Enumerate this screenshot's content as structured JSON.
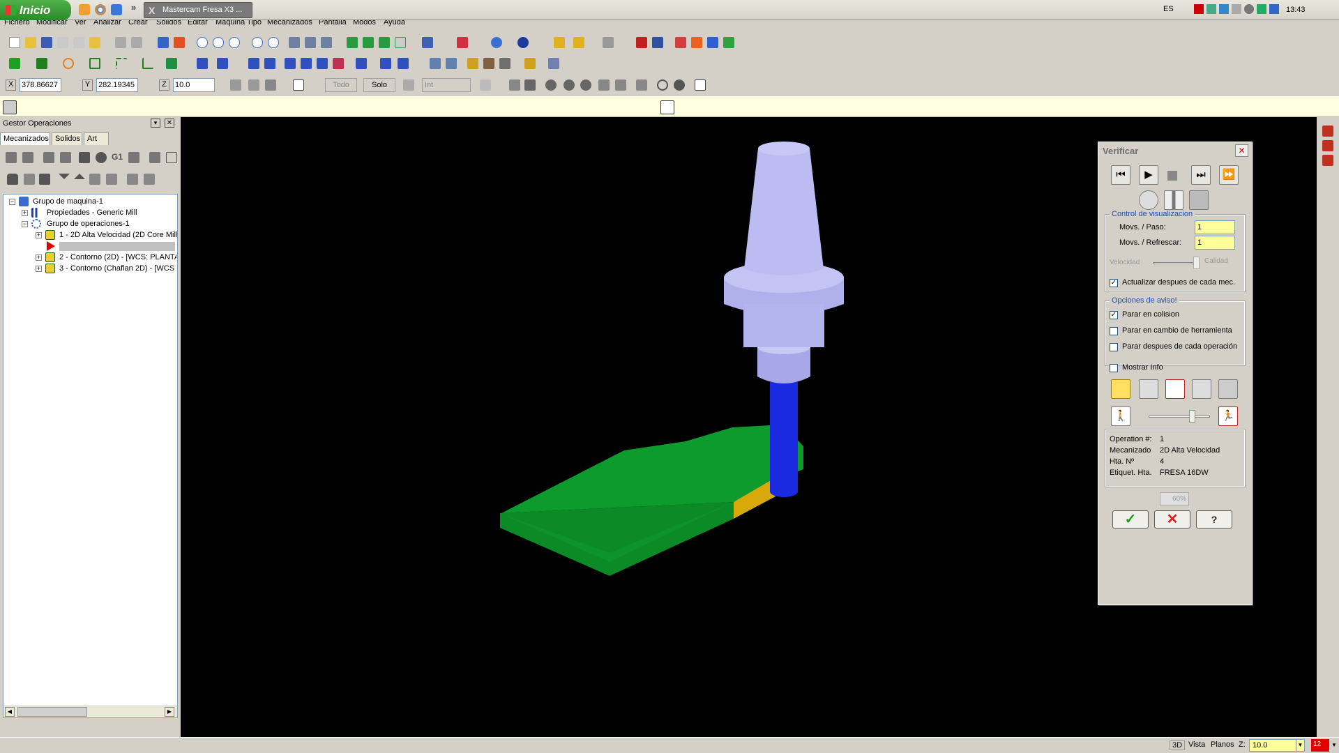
{
  "taskbar": {
    "start_label": "Inicio",
    "task_button": "Mastercam Fresa X3 ...",
    "lang": "ES",
    "clock": "13:43",
    "chevron": "»"
  },
  "menu": [
    "Fichero",
    "Modificar",
    "Ver",
    "Analizar",
    "Crear",
    "Solidos",
    "Editar",
    "Maquina Tipo",
    "Mecanizados",
    "Pantalla",
    "Modos",
    "Ayuda"
  ],
  "coords": {
    "x_label": "X",
    "x_value": "378.86627",
    "y_label": "Y",
    "y_value": "282.19345",
    "z_label": "Z",
    "z_value": "10.0",
    "todo": "Todo",
    "solo": "Solo",
    "int": "Int"
  },
  "ops_manager": {
    "title": "Gestor Operaciones",
    "tabs": [
      "Mecanizados",
      "Solidos",
      "Art"
    ],
    "tree": {
      "root": "Grupo de maquina-1",
      "properties": "Propiedades - Generic Mill",
      "group": "Grupo de operaciones-1",
      "ops": [
        "1 - 2D Alta Velocidad (2D Core Mill)",
        "2 - Contorno  (2D) - [WCS: PLANTA",
        "3 - Contorno  (Chaflan 2D) - [WCS"
      ]
    }
  },
  "verify": {
    "title": "Verificar",
    "display_group": "Control de visualizacion",
    "movs_paso_label": "Movs. / Paso:",
    "movs_paso_value": "1",
    "movs_refrescar_label": "Movs. / Refrescar:",
    "movs_refrescar_value": "1",
    "velocidad": "Velocidad",
    "calidad": "Calidad",
    "actualizar": "Actualizar despues de cada mec.",
    "warn_group": "Opciones de aviso!",
    "parar_colision": "Parar en colision",
    "parar_cambio": "Parar en cambio de herramienta",
    "parar_despues": "Parar despues de cada operación",
    "mostrar_info": "Mostrar Info",
    "info": {
      "op_label": "Operation #:",
      "op_value": "1",
      "mec_label": "Mecanizado",
      "mec_value": "2D Alta Velocidad",
      "hta_label": "Hta. Nº",
      "hta_value": "4",
      "etiq_label": "Etiquet. Hta.",
      "etiq_value": "FRESA 16DW"
    },
    "progress": "60%",
    "progress_value": 0.6,
    "checks": {
      "actualizar": true,
      "colision": true,
      "cambio": false,
      "despues": false,
      "mostrar": false
    }
  },
  "status": {
    "mode_3d": "3D",
    "vista": "Vista",
    "planos": "Planos",
    "z_label": "Z:",
    "z_value": "10.0",
    "level": "12"
  },
  "colors": {
    "part_top": "#0d9b2e",
    "part_side": "#0b8a25",
    "chamfer": "#d9a80a",
    "tool_cutter": "#1a2ae0",
    "holder": "#b8b8f0",
    "accent_yellow": "#ffff99"
  }
}
